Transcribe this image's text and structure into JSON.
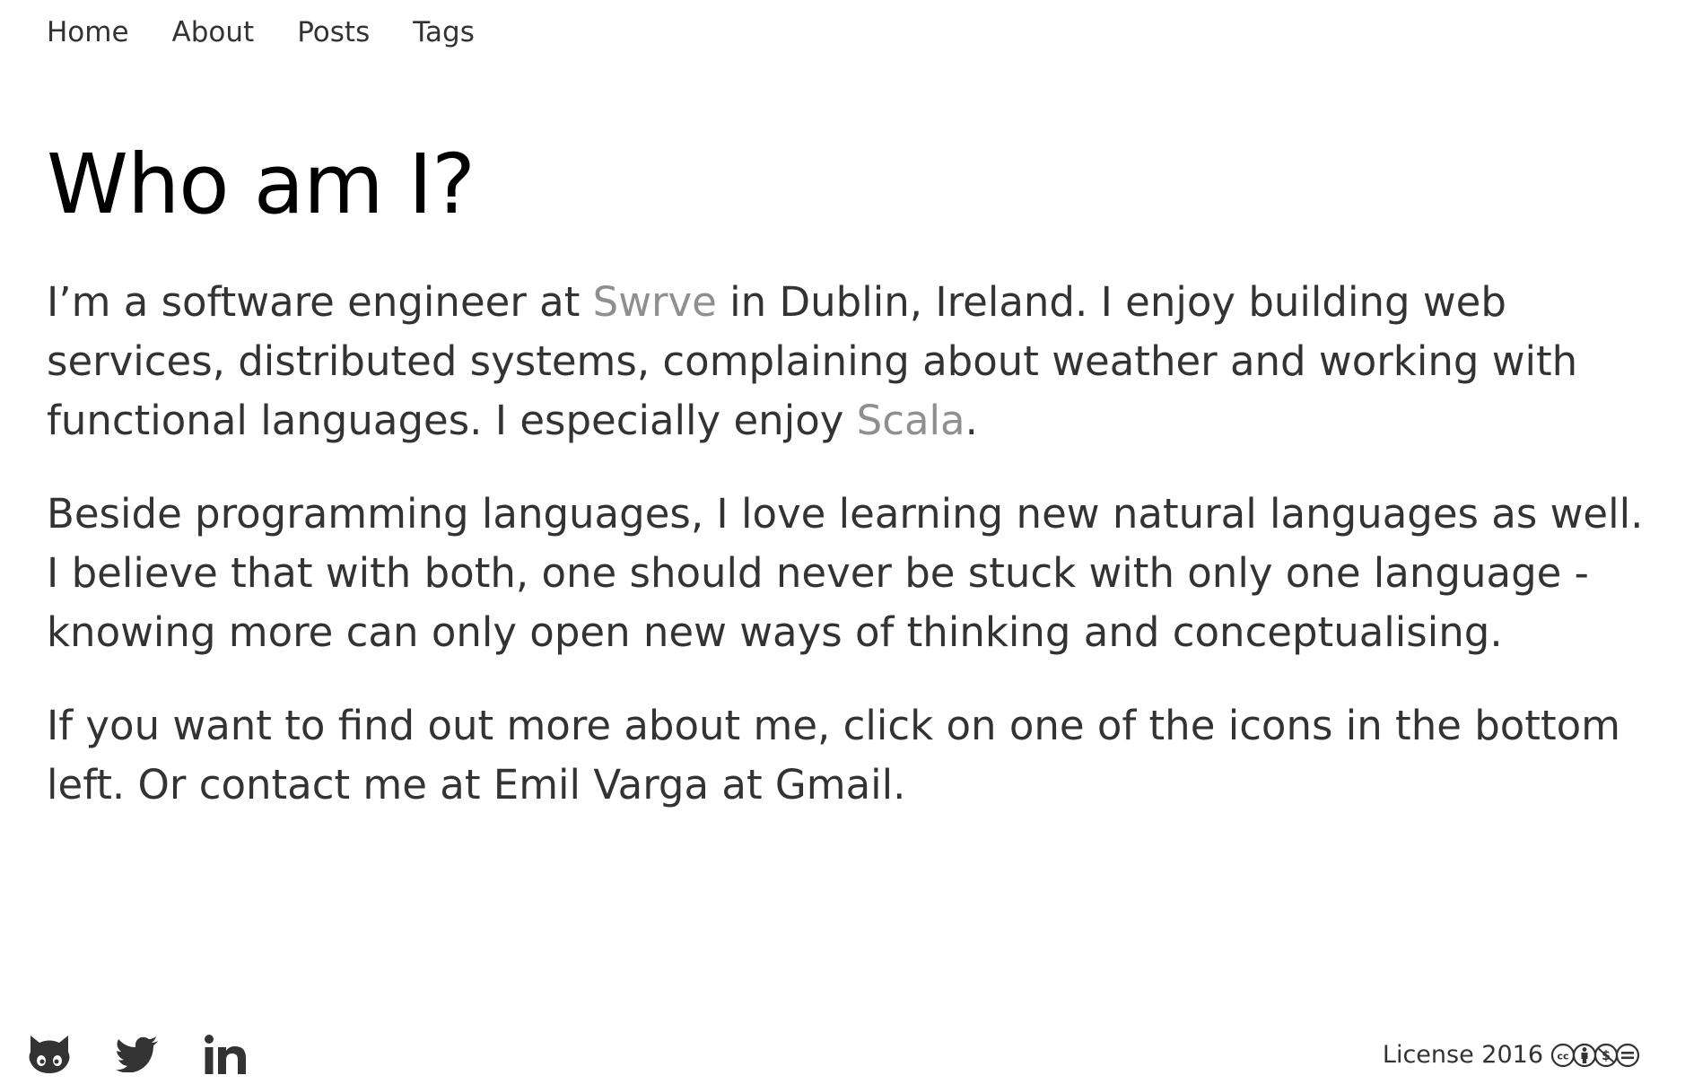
{
  "nav": {
    "items": [
      "Home",
      "About",
      "Posts",
      "Tags"
    ]
  },
  "main": {
    "title": "Who am I?",
    "paragraph1": {
      "before_link": "I’m a software engineer at ",
      "link1": "Swrve",
      "middle": " in Dublin, Ireland. I enjoy building web services, distributed systems, complaining about weather and working with functional languages. I especially enjoy ",
      "link2": "Scala",
      "after": "."
    },
    "paragraph2": "Beside programming languages, I love learning new natural languages as well. I believe that with both, one should never be stuck with only one language - knowing more can only open new ways of thinking and conceptualising.",
    "paragraph3": "If you want to find out more about me, click on one of the icons in the bottom left. Or contact me at Emil Varga at Gmail."
  },
  "footer": {
    "social_icons": [
      "github-icon",
      "twitter-icon",
      "linkedin-icon"
    ],
    "license_text": "License 2016",
    "license_icons": [
      "cc-icon",
      "by-icon",
      "nc-icon",
      "nd-icon"
    ]
  },
  "colors": {
    "text": "#333333",
    "heading": "#000000",
    "link": "#8f8f8f",
    "background": "#ffffff"
  }
}
